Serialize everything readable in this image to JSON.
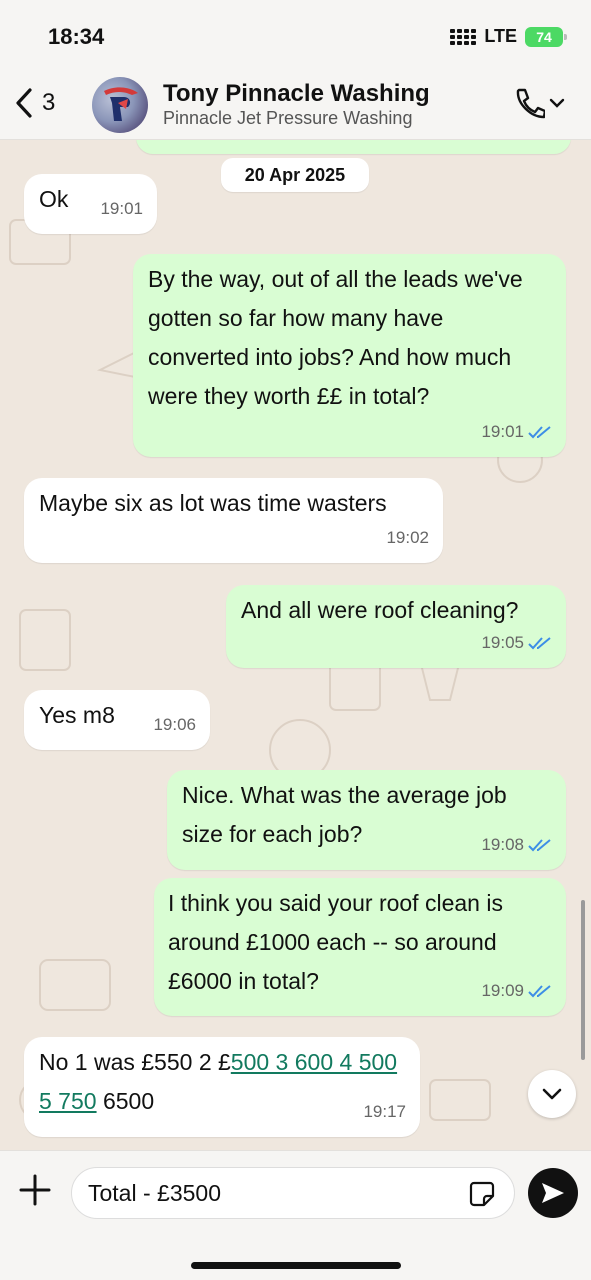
{
  "status": {
    "time": "18:34",
    "network": "LTE",
    "battery": "74"
  },
  "header": {
    "back_count": "3",
    "contact_name": "Tony Pinnacle Washing",
    "contact_subtitle": "Pinnacle Jet Pressure Washing"
  },
  "chat": {
    "date": "20 Apr 2025",
    "messages": [
      {
        "dir": "in",
        "text": "Ok",
        "time": "19:01"
      },
      {
        "dir": "out",
        "text": "By the way, out of all the leads we've gotten so far how many have converted into jobs? And how much were they worth ££ in total?",
        "time": "19:01",
        "read": true
      },
      {
        "dir": "in",
        "text": "Maybe six as lot was time wasters",
        "time": "19:02"
      },
      {
        "dir": "out",
        "text": "And all were roof cleaning?",
        "time": "19:05",
        "read": true
      },
      {
        "dir": "in",
        "text": "Yes m8",
        "time": "19:06"
      },
      {
        "dir": "out",
        "text": "Nice. What was the average job size for each job?",
        "time": "19:08",
        "read": true
      },
      {
        "dir": "out",
        "text": "I think you said your roof clean is around £1000 each -- so around £6000 in total?",
        "time": "19:09",
        "read": true
      },
      {
        "dir": "in",
        "text_before": "No 1 was £550 2 £",
        "text_link": "500 3 600 4 500 5 750",
        "text_after": " 6500",
        "time": "19:17"
      }
    ]
  },
  "composer": {
    "value": "Total - £3500"
  },
  "colors": {
    "incoming": "#ffffff",
    "outgoing": "#d9fdd3",
    "read_ticks": "#3d8ee6",
    "link": "#127a5f"
  }
}
